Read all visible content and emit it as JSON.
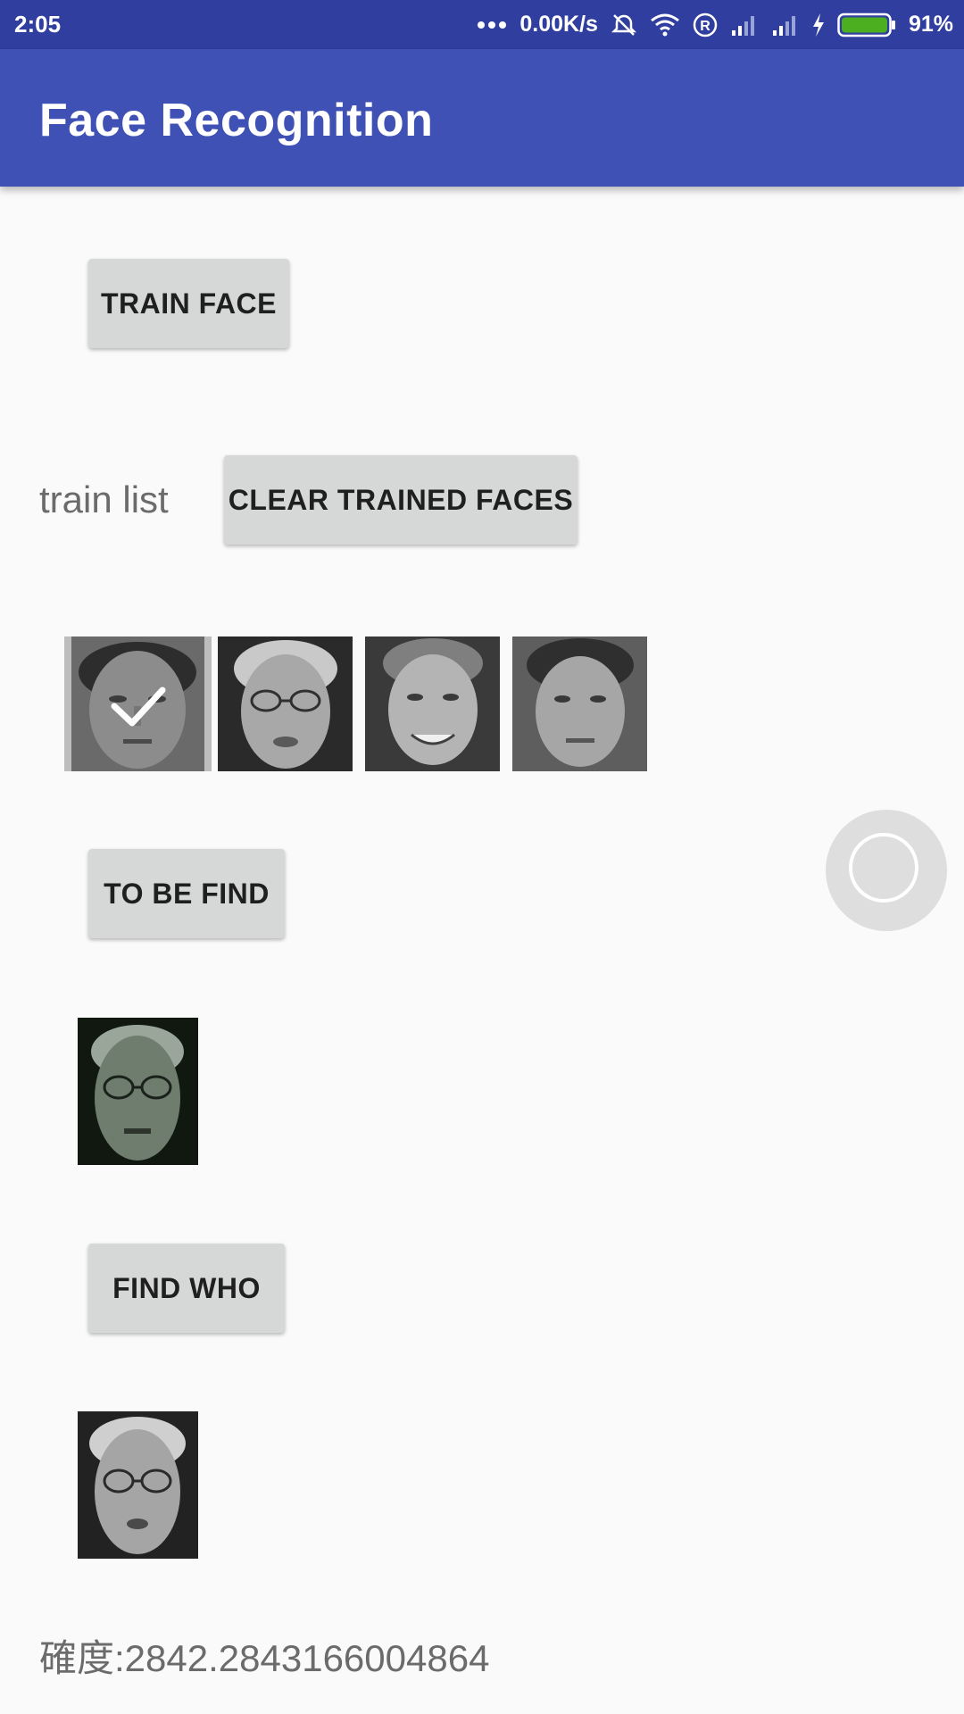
{
  "status_bar": {
    "time": "2:05",
    "net_speed": "0.00K/s",
    "battery": "91%",
    "icons": [
      "dots-icon",
      "alarm-off-icon",
      "wifi-icon",
      "registered-icon",
      "signal-icon",
      "signal-icon-2",
      "charging-icon",
      "battery-icon"
    ]
  },
  "app_bar": {
    "title": "Face Recognition"
  },
  "buttons": {
    "train_face": "TRAIN FACE",
    "clear_trained": "CLEAR TRAINED FACES",
    "to_be_find": "TO BE FIND",
    "find_who": "FIND WHO"
  },
  "train_list_label": "train list",
  "train_faces": [
    {
      "name": "face-1",
      "selected": true
    },
    {
      "name": "face-2",
      "selected": false
    },
    {
      "name": "face-3",
      "selected": false
    },
    {
      "name": "face-4",
      "selected": false
    }
  ],
  "result_text": "確度:2842.2843166004864",
  "colors": {
    "status_bar": "#303f9f",
    "app_bar": "#3f51b5",
    "button": "#d6d7d7",
    "battery_fill": "#4caf1f"
  }
}
